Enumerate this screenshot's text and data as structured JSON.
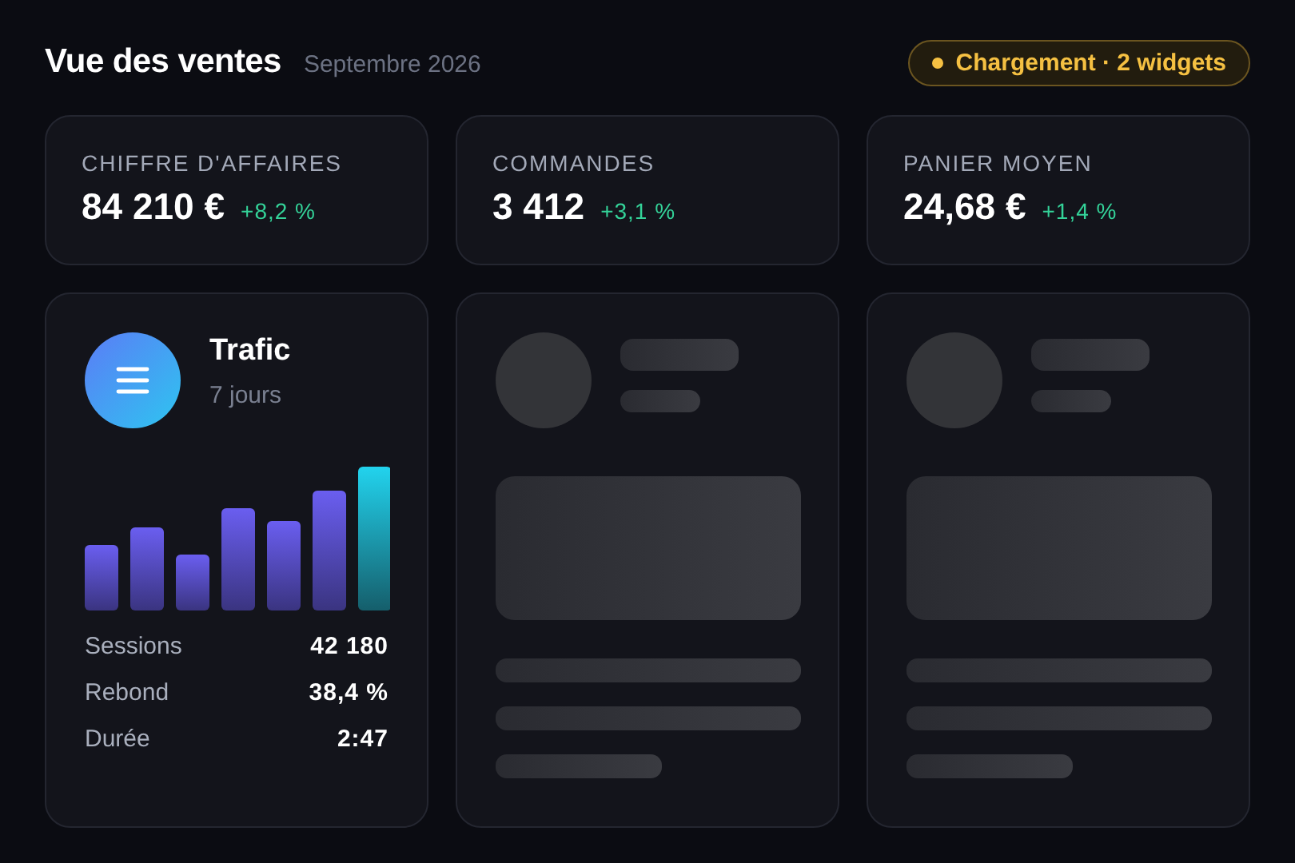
{
  "header": {
    "title": "Vue des ventes",
    "subtitle": "Septembre 2026",
    "status": {
      "label": "Chargement · 2 widgets",
      "color": "#f5c042"
    }
  },
  "kpis": [
    {
      "label": "CHIFFRE D'AFFAIRES",
      "value": "84 210 €",
      "delta": "+8,2 %"
    },
    {
      "label": "COMMANDES",
      "value": "3 412",
      "delta": "+3,1 %"
    },
    {
      "label": "PANIER MOYEN",
      "value": "24,68 €",
      "delta": "+1,4 %"
    }
  ],
  "widgets": [
    {
      "kind": "traffic",
      "title": "Trafic",
      "subtitle": "7 jours",
      "stats": [
        {
          "label": "Sessions",
          "value": "42 180"
        },
        {
          "label": "Rebond",
          "value": "38,4 %"
        },
        {
          "label": "Durée",
          "value": "2:47"
        }
      ]
    },
    {
      "kind": "skeleton"
    },
    {
      "kind": "skeleton"
    }
  ]
}
